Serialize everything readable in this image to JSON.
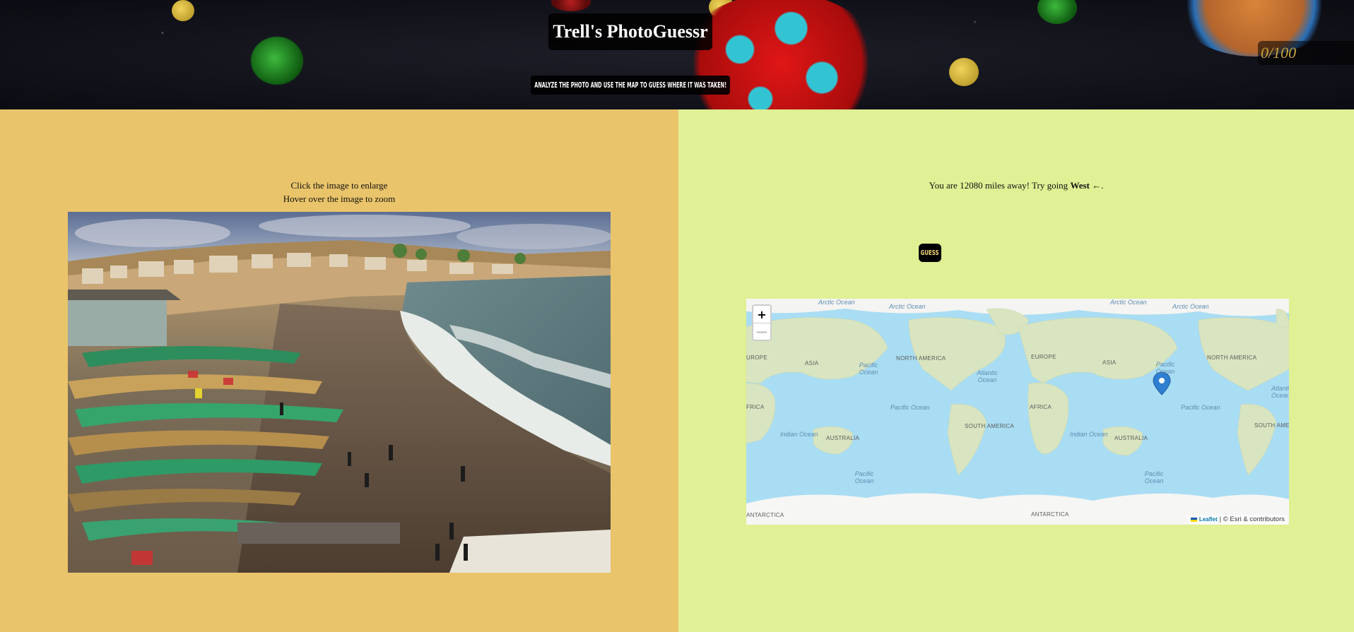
{
  "header": {
    "title": "Trell's PhotoGuessr",
    "subtitle": "Analyze the photo and use the map to guess where it was taken!",
    "score": "0/100"
  },
  "photo_panel": {
    "hint_enlarge": "Click the image to enlarge",
    "hint_zoom": "Hover over the image to zoom"
  },
  "guess_panel": {
    "distance_prefix": "You are 12080 miles away! Try going ",
    "direction": "West",
    "direction_suffix": " ←.",
    "guess_button": "GUESS"
  },
  "map": {
    "zoom_in": "+",
    "zoom_out": "—",
    "attribution_leaflet": "Leaflet",
    "attribution_text": "| © Esri & contributors",
    "labels": {
      "arctic1": "Arctic Ocean",
      "arctic2": "Arctic Ocean",
      "arctic3": "Arctic Ocean",
      "arctic4": "Arctic Ocean",
      "europe1": "UROPE",
      "asia1": "ASIA",
      "pacific1": "Pacific Ocean",
      "north_america1": "NORTH AMERICA",
      "atlantic1": "Atlantic Ocean",
      "europe2": "EUROPE",
      "asia2": "ASIA",
      "pacific2": "Pacific Ocean",
      "north_america2": "NORTH AMERICA",
      "africa1": "FRICA",
      "pacific3": "Pacific Ocean",
      "africa2": "AFRICA",
      "pacific4": "Pacific Ocean",
      "atlantic2": "Atlanti Ocean",
      "south_america1": "SOUTH AMERICA",
      "south_america2": "SOUTH AMERICA",
      "indian1": "Indian Ocean",
      "australia1": "AUSTRALIA",
      "indian2": "Indian Ocean",
      "australia2": "AUSTRALIA",
      "pacific5": "Pacific Ocean",
      "pacific6": "Pacific Ocean",
      "antarctica1": "ANTARCTICA",
      "antarctica2": "ANTARCTICA"
    }
  },
  "colors": {
    "left_bg": "#e9c46a",
    "right_bg": "#dff095",
    "score_text": "#c9a640",
    "guess_text": "#f3d57a",
    "marker": "#2f7fd1"
  }
}
